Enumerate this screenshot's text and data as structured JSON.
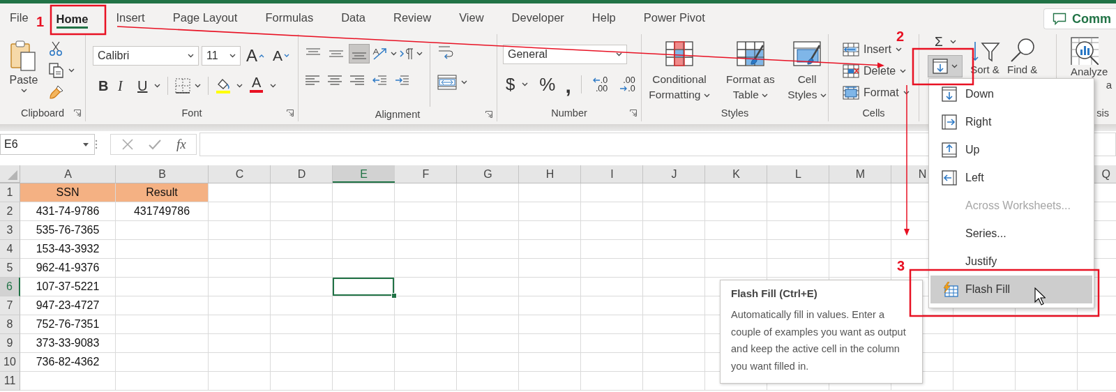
{
  "tabs": [
    {
      "label": "File",
      "selected": false
    },
    {
      "label": "Home",
      "selected": true
    },
    {
      "label": "Insert",
      "selected": false
    },
    {
      "label": "Page Layout",
      "selected": false
    },
    {
      "label": "Formulas",
      "selected": false
    },
    {
      "label": "Data",
      "selected": false
    },
    {
      "label": "Review",
      "selected": false
    },
    {
      "label": "View",
      "selected": false
    },
    {
      "label": "Developer",
      "selected": false
    },
    {
      "label": "Help",
      "selected": false
    },
    {
      "label": "Power Pivot",
      "selected": false
    }
  ],
  "comments_button": {
    "label": "Comm"
  },
  "ribbon": {
    "clipboard": {
      "label": "Clipboard",
      "paste": "Paste"
    },
    "font": {
      "label": "Font",
      "font_name": "Calibri",
      "font_size": "11",
      "grow_font": "A",
      "shrink_font": "A",
      "bold": "B",
      "italic": "I",
      "underline": "U",
      "font_color": "A"
    },
    "alignment": {
      "label": "Alignment",
      "valign": [
        {
          "kind": "top",
          "selected": false
        },
        {
          "kind": "middle",
          "selected": false
        },
        {
          "kind": "bottom",
          "selected": true
        }
      ]
    },
    "number": {
      "label": "Number",
      "format": "General",
      "currency": "$",
      "percent": "%",
      "comma": ",",
      "increase_decimal": {
        "top": ".0",
        "bottom": ".00"
      },
      "decrease_decimal": {
        "top": ".00",
        "bottom": ".0"
      }
    },
    "styles": {
      "label": "Styles",
      "buttons": [
        {
          "label": "Conditional Formatting",
          "kind": "conditional"
        },
        {
          "label": "Format as Table",
          "kind": "table"
        },
        {
          "label": "Cell Styles",
          "kind": "cell"
        }
      ]
    },
    "cells": {
      "label": "Cells",
      "buttons": [
        {
          "label": "Insert",
          "kind": "insert"
        },
        {
          "label": "Delete",
          "kind": "delete"
        },
        {
          "label": "Format",
          "kind": "format"
        }
      ]
    },
    "editing": {
      "autosum": "Σ",
      "fill": {
        "expanded": true
      },
      "sort_filter": "Sort &",
      "find_select": "Find &"
    },
    "analysis": {
      "analyze_data": [
        "Analyze",
        "a"
      ],
      "label": "sis"
    }
  },
  "formula_bar": {
    "name_box": "E6",
    "fx": "fx"
  },
  "sheet": {
    "columns": [
      {
        "label": "A",
        "selected": false
      },
      {
        "label": "B",
        "selected": false
      },
      {
        "label": "C",
        "selected": false
      },
      {
        "label": "D",
        "selected": false
      },
      {
        "label": "E",
        "selected": true
      },
      {
        "label": "F",
        "selected": false
      },
      {
        "label": "G",
        "selected": false
      },
      {
        "label": "H",
        "selected": false
      },
      {
        "label": "I",
        "selected": false
      },
      {
        "label": "J",
        "selected": false
      },
      {
        "label": "K",
        "selected": false
      },
      {
        "label": "L",
        "selected": false
      },
      {
        "label": "M",
        "selected": false
      },
      {
        "label": "N",
        "selected": false
      },
      {
        "label": "Q",
        "selected": false
      }
    ],
    "rows": [
      {
        "header": "1",
        "kind": "heading",
        "selected": false,
        "cells": [
          "SSN",
          "Result"
        ]
      },
      {
        "header": "2",
        "kind": "data",
        "selected": false,
        "cells": [
          "431-74-9786",
          "431749786"
        ]
      },
      {
        "header": "3",
        "kind": "data",
        "selected": false,
        "cells": [
          "535-76-7365"
        ]
      },
      {
        "header": "4",
        "kind": "data",
        "selected": false,
        "cells": [
          "153-43-3932"
        ]
      },
      {
        "header": "5",
        "kind": "data",
        "selected": false,
        "cells": [
          "962-41-9376"
        ]
      },
      {
        "header": "6",
        "kind": "data",
        "selected": true,
        "cells": [
          "107-37-5221"
        ]
      },
      {
        "header": "7",
        "kind": "data",
        "selected": false,
        "cells": [
          "947-23-4727"
        ]
      },
      {
        "header": "8",
        "kind": "data",
        "selected": false,
        "cells": [
          "752-76-7351"
        ]
      },
      {
        "header": "9",
        "kind": "data",
        "selected": false,
        "cells": [
          "373-33-9083"
        ]
      },
      {
        "header": "10",
        "kind": "data",
        "selected": false,
        "cells": [
          "736-82-4362"
        ]
      },
      {
        "header": "11",
        "selected": false
      }
    ]
  },
  "fill_menu": {
    "items": [
      {
        "label": "Down",
        "kind": "down",
        "disabled": false,
        "selected": false
      },
      {
        "label": "Right",
        "kind": "right",
        "disabled": false,
        "selected": false
      },
      {
        "label": "Up",
        "kind": "up",
        "disabled": false,
        "selected": false
      },
      {
        "label": "Left",
        "kind": "left",
        "disabled": false,
        "selected": false
      },
      {
        "label": "Across Worksheets...",
        "kind": "none",
        "disabled": true,
        "selected": false
      },
      {
        "label": "Series...",
        "kind": "none",
        "disabled": false,
        "selected": false
      },
      {
        "label": "Justify",
        "kind": "none",
        "disabled": false,
        "selected": false
      },
      {
        "label": "Flash Fill",
        "kind": "flash",
        "disabled": false,
        "selected": true
      }
    ]
  },
  "tooltip": {
    "title": "Flash Fill (Ctrl+E)",
    "body": "Automatically fill in values. Enter a couple of examples you want as output and keep the active cell in the column you want filled in."
  },
  "annotations": [
    {
      "number": "1"
    },
    {
      "number": "2"
    },
    {
      "number": "3"
    }
  ]
}
